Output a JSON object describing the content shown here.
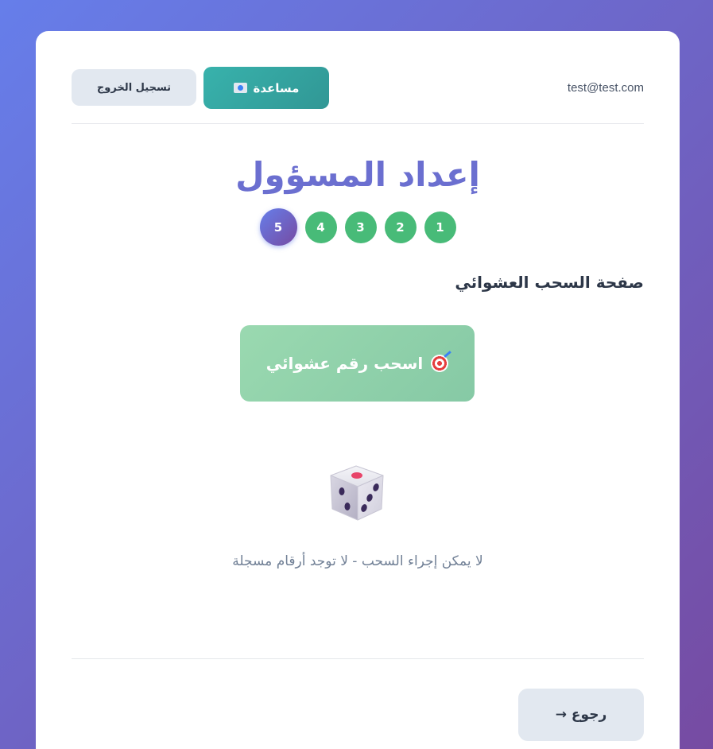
{
  "header": {
    "user_email": "test@test.com",
    "help_label": "مساعدة",
    "logout_label": "تسجيل الخروج"
  },
  "title": "إعداد المسؤول",
  "steps": {
    "items": [
      "1",
      "2",
      "3",
      "4",
      "5"
    ],
    "current": "5"
  },
  "section": {
    "title": "صفحة السحب العشوائي"
  },
  "draw_button": {
    "label": "اسحب رقم عشوائي",
    "icon": "target-icon"
  },
  "empty_state": {
    "icon": "dice-icon",
    "message": "لا يمكن إجراء السحب - لا توجد أرقام مسجلة"
  },
  "footer": {
    "back_label": "رجوع →"
  },
  "colors": {
    "accent_purple": "#6b6fd0",
    "step_done": "#48bb78",
    "help_teal": "#38b2ac",
    "draw_green": "#9ad9b0"
  }
}
